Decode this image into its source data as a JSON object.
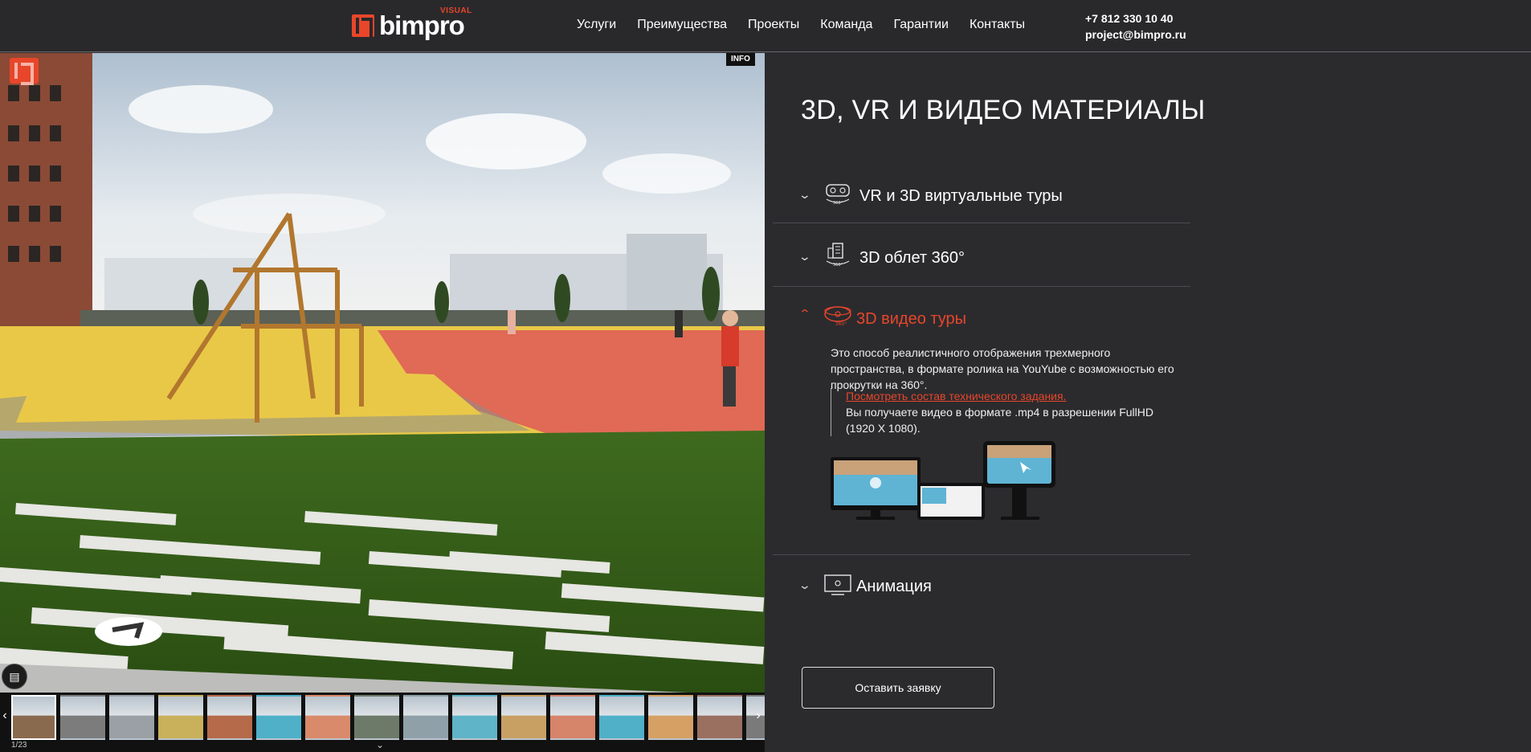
{
  "header": {
    "logo_text": "bimpro",
    "logo_sub": "VISUAL",
    "nav": [
      "Услуги",
      "Преимущества",
      "Проекты",
      "Команда",
      "Гарантии",
      "Контакты"
    ],
    "phone": "+7 812 330 10 40",
    "email": "project@bimpro.ru"
  },
  "viewer": {
    "info_label": "INFO",
    "counter": "1/23",
    "thumb_count": 16
  },
  "panel": {
    "title": "3D, VR И ВИДЕО МАТЕРИАЛЫ",
    "accordion": [
      {
        "title": "VR и 3D виртуальные туры",
        "open": false
      },
      {
        "title": "3D облет 360°",
        "open": false
      },
      {
        "title": "3D видео туры",
        "open": true,
        "description": "Это способ реалистичного отображения трехмерного пространства, в формате ролика на YouYube с возможностью его прокрутки на 360°.",
        "link_text": "Посмотреть состав технического задания.",
        "note": "Вы получаете видео в формате .mp4 в разрешении FullHD (1920 X 1080)."
      },
      {
        "title": "Анимация",
        "open": false
      }
    ],
    "cta_label": "Оставить заявку"
  },
  "colors": {
    "accent": "#e8462a",
    "header_bg": "#29292c",
    "panel_bg": "#2b2b2e"
  }
}
